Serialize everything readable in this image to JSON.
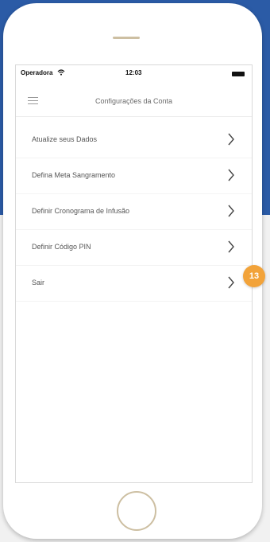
{
  "status_bar": {
    "carrier": "Operadora",
    "wifi_icon": "wifi-icon",
    "time": "12:03",
    "battery_icon": "battery-icon"
  },
  "nav": {
    "menu_icon": "hamburger-menu-icon",
    "title": "Configurações da Conta"
  },
  "menu": {
    "items": [
      {
        "label": "Atualize seus Dados",
        "icon": "chevron-right-icon"
      },
      {
        "label": "Defina Meta Sangramento",
        "icon": "chevron-right-icon"
      },
      {
        "label": "Definir Cronograma de Infusão",
        "icon": "chevron-right-icon"
      },
      {
        "label": "Definir Código PIN",
        "icon": "chevron-right-icon"
      },
      {
        "label": "Sair",
        "icon": "chevron-right-icon"
      }
    ]
  },
  "callout": {
    "number": "13"
  },
  "colors": {
    "background_blue": "#2b5ba6",
    "badge_orange": "#f2a33a",
    "phone_accent": "#cdbfa2"
  }
}
